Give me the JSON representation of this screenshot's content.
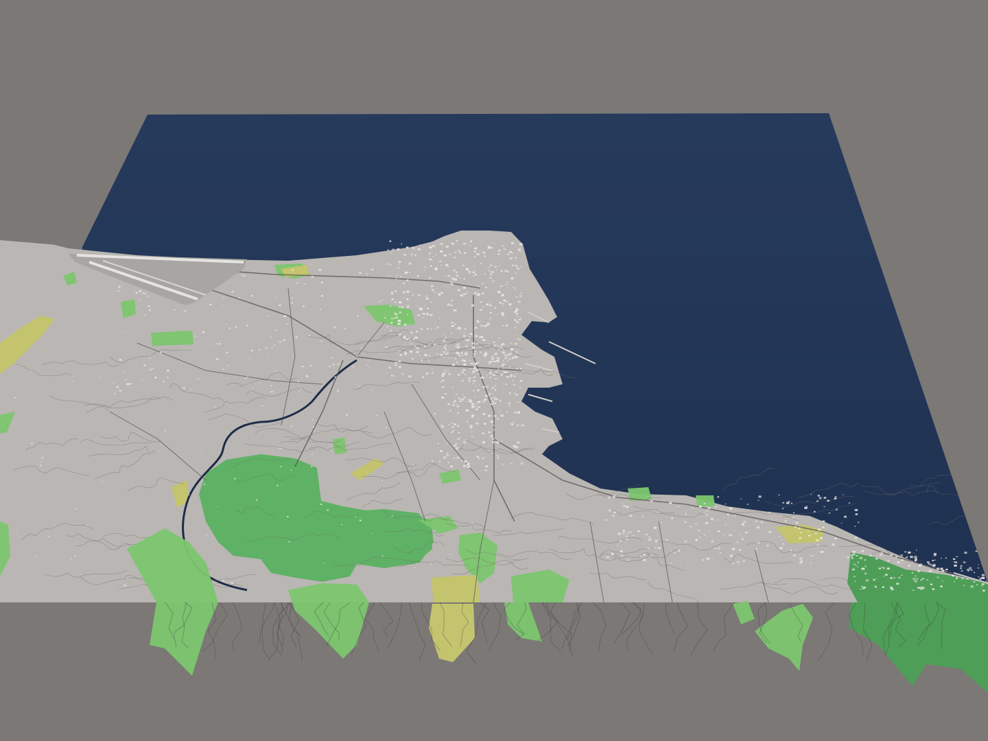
{
  "scene": {
    "kind": "3d-city-terrain-render",
    "labels_visible": false,
    "colors": {
      "background": "#7b7876",
      "sea": "#1f3150",
      "sea_highlight": "#263a5c",
      "land": "#b9b6b3",
      "land_shade": "#a9a6a3",
      "forest": "#5fb165",
      "forest_dark": "#4e9e57",
      "park": "#7cc66f",
      "farmland": "#c4c46e",
      "roads": "#5c5a58",
      "river": "#1d2b48",
      "buildings": "#e9e7e4"
    },
    "layers": [
      "sea",
      "land",
      "forest",
      "parks",
      "farmland",
      "river",
      "roads",
      "contours",
      "buildings",
      "airport"
    ]
  }
}
